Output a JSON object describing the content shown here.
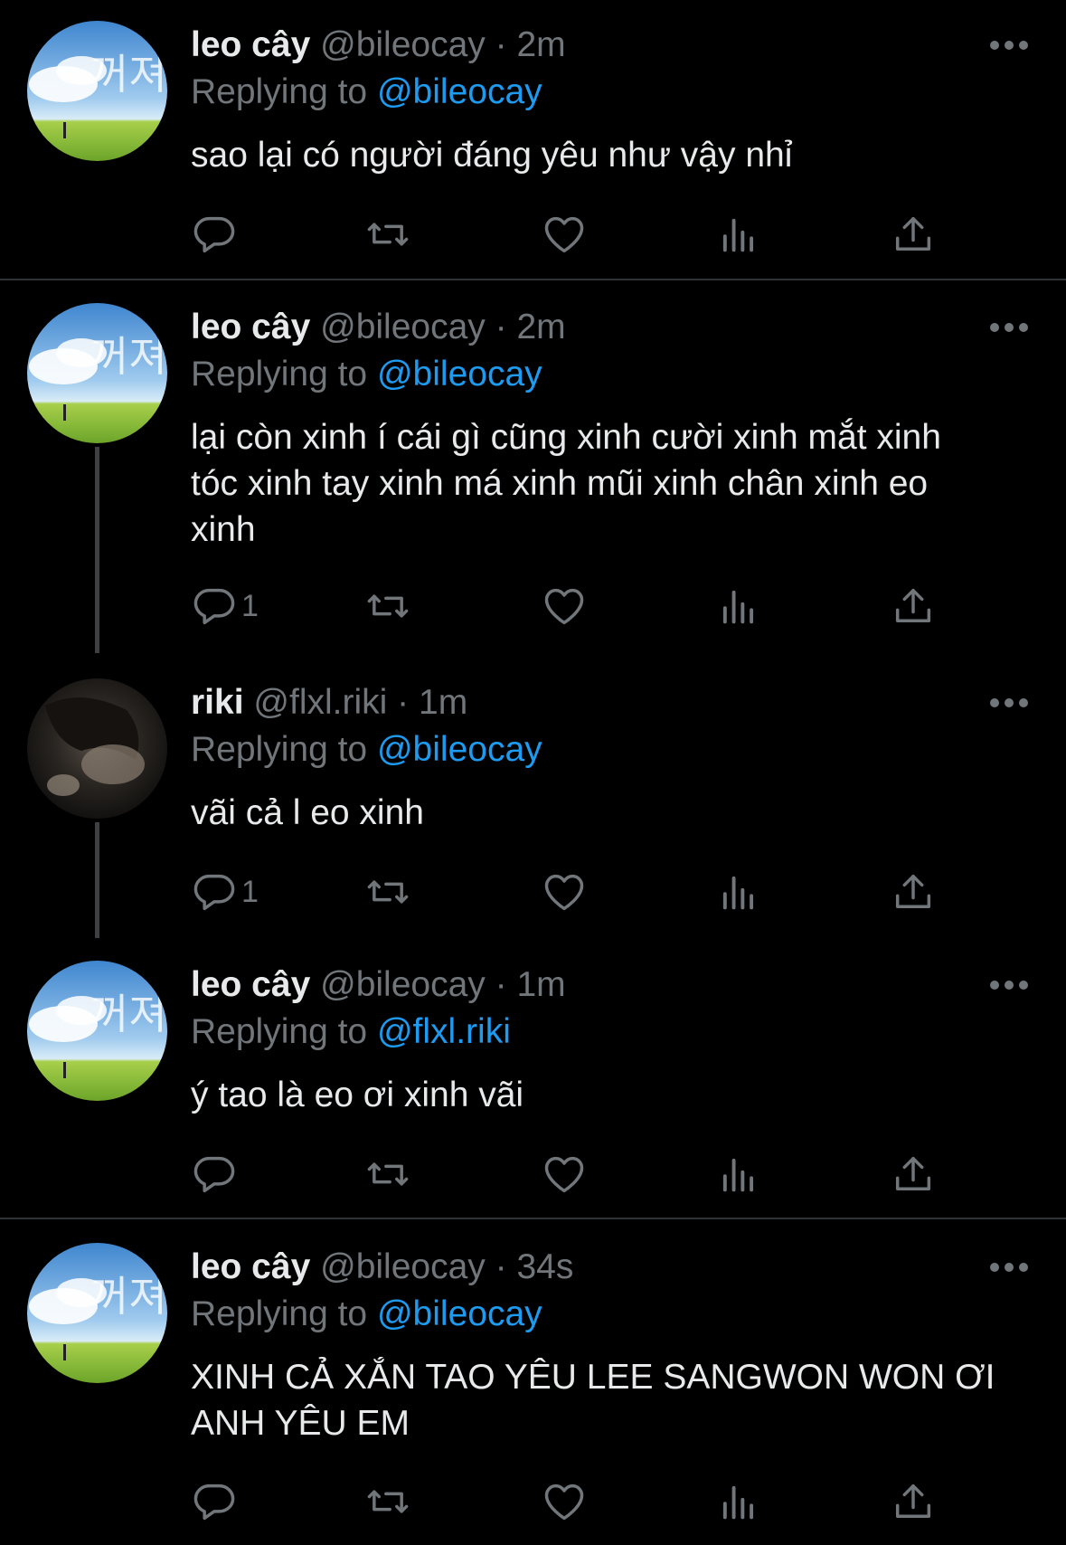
{
  "colors": {
    "background": "#000000",
    "text": "#e7e9ea",
    "muted": "#71767b",
    "accent": "#1d9bf0",
    "divider": "#2f3336"
  },
  "reply_prefix": "Replying to",
  "dot": "·",
  "tweets": [
    {
      "name": "leo cây",
      "handle": "@bileocay",
      "time": "2m",
      "replying_to": "@bileocay",
      "text": "sao lại có người đáng yêu như vậy nhỉ",
      "reply_count": "",
      "avatar": "sky-avatar"
    },
    {
      "name": "leo cây",
      "handle": "@bileocay",
      "time": "2m",
      "replying_to": "@bileocay",
      "text": "lại còn xinh í cái gì cũng xinh cười xinh mắt xinh tóc xinh tay xinh má xinh mũi xinh chân xinh eo xinh",
      "reply_count": "1",
      "avatar": "sky-avatar"
    },
    {
      "name": "riki",
      "handle": "@flxl.riki",
      "time": "1m",
      "replying_to": "@bileocay",
      "text": "vãi cả l eo xinh",
      "reply_count": "1",
      "avatar": "photo-avatar"
    },
    {
      "name": "leo cây",
      "handle": "@bileocay",
      "time": "1m",
      "replying_to": "@flxl.riki",
      "text": "ý tao là eo ơi xinh vãi",
      "reply_count": "",
      "avatar": "sky-avatar"
    },
    {
      "name": "leo cây",
      "handle": "@bileocay",
      "time": "34s",
      "replying_to": "@bileocay",
      "text": "XINH CẢ XẮN TAO YÊU LEE SANGWON WON ƠI ANH YÊU EM",
      "reply_count": "",
      "avatar": "sky-avatar"
    }
  ],
  "icons": {
    "more": "more-horizontal-icon",
    "reply": "reply-bubble-icon",
    "retweet": "retweet-icon",
    "like": "heart-icon",
    "views": "views-bar-chart-icon",
    "share": "share-upload-icon"
  }
}
